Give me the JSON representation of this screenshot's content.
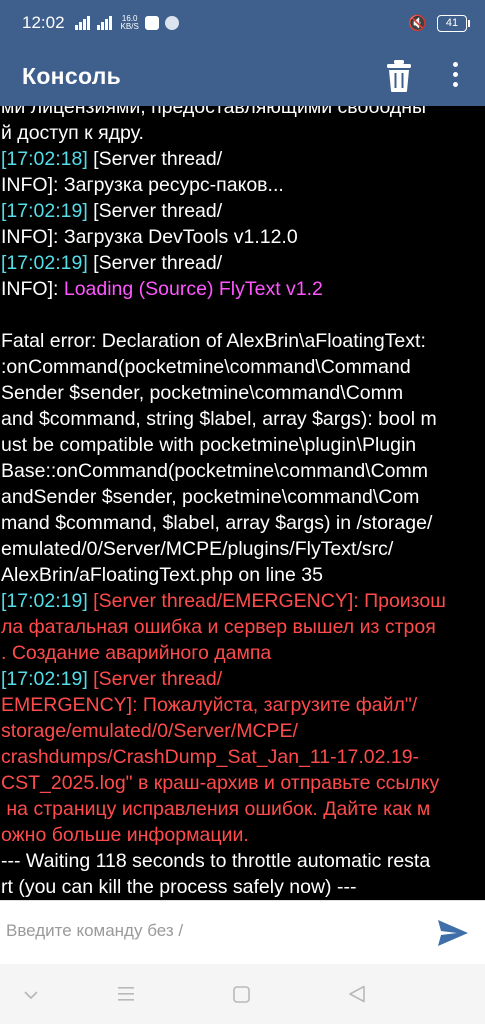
{
  "status_bar": {
    "time": "12:02",
    "network_speed": "16.0",
    "network_unit": "KB/S",
    "battery": "41",
    "icons": [
      "signal-4g-icon",
      "signal-icon",
      "calendar-icon",
      "notification-icon",
      "mute-icon",
      "battery-icon"
    ]
  },
  "app_bar": {
    "title": "Консоль",
    "delete_icon": "trash-icon",
    "more_icon": "more-vert-icon"
  },
  "console": {
    "lines": [
      {
        "segments": [
          {
            "text": "ми лицензиями, предоставляющими свободны",
            "color": "#ffffff"
          }
        ]
      },
      {
        "segments": [
          {
            "text": "й доступ к ядру.",
            "color": "#ffffff"
          }
        ]
      },
      {
        "segments": [
          {
            "text": "[17:02:18]",
            "color": "#55dde8"
          },
          {
            "text": " [Server thread/",
            "color": "#ffffff"
          }
        ]
      },
      {
        "segments": [
          {
            "text": "INFO]: Загрузка ресурс-паков...",
            "color": "#ffffff"
          }
        ]
      },
      {
        "segments": [
          {
            "text": "[17:02:19]",
            "color": "#55dde8"
          },
          {
            "text": " [Server thread/",
            "color": "#ffffff"
          }
        ]
      },
      {
        "segments": [
          {
            "text": "INFO]: Загрузка DevTools v1.12.0",
            "color": "#ffffff"
          }
        ]
      },
      {
        "segments": [
          {
            "text": "[17:02:19]",
            "color": "#55dde8"
          },
          {
            "text": " [Server thread/",
            "color": "#ffffff"
          }
        ]
      },
      {
        "segments": [
          {
            "text": "INFO]: ",
            "color": "#ffffff"
          },
          {
            "text": "Loading (Source) FlyText v1.2",
            "color": "#ff55ff"
          }
        ]
      },
      {
        "segments": [
          {
            "text": "",
            "color": "#ffffff"
          }
        ]
      },
      {
        "segments": [
          {
            "text": "Fatal error: Declaration of AlexBrin\\aFloatingText:",
            "color": "#ffffff"
          }
        ]
      },
      {
        "segments": [
          {
            "text": ":onCommand(pocketmine\\command\\Command",
            "color": "#ffffff"
          }
        ]
      },
      {
        "segments": [
          {
            "text": "Sender $sender, pocketmine\\command\\Comm",
            "color": "#ffffff"
          }
        ]
      },
      {
        "segments": [
          {
            "text": "and $command, string $label, array $args): bool m",
            "color": "#ffffff"
          }
        ]
      },
      {
        "segments": [
          {
            "text": "ust be compatible with pocketmine\\plugin\\Plugin",
            "color": "#ffffff"
          }
        ]
      },
      {
        "segments": [
          {
            "text": "Base::onCommand(pocketmine\\command\\Comm",
            "color": "#ffffff"
          }
        ]
      },
      {
        "segments": [
          {
            "text": "andSender $sender, pocketmine\\command\\Com",
            "color": "#ffffff"
          }
        ]
      },
      {
        "segments": [
          {
            "text": "mand $command, $label, array $args) in /storage/",
            "color": "#ffffff"
          }
        ]
      },
      {
        "segments": [
          {
            "text": "emulated/0/Server/MCPE/plugins/FlyText/src/",
            "color": "#ffffff"
          }
        ]
      },
      {
        "segments": [
          {
            "text": "AlexBrin/aFloatingText.php on line 35",
            "color": "#ffffff"
          }
        ]
      },
      {
        "segments": [
          {
            "text": "[17:02:19]",
            "color": "#55dde8"
          },
          {
            "text": " [Server thread/EMERGENCY]: Произош",
            "color": "#ff4b4b"
          }
        ]
      },
      {
        "segments": [
          {
            "text": "ла фатальная ошибка и сервер вышел из строя",
            "color": "#ff4b4b"
          }
        ]
      },
      {
        "segments": [
          {
            "text": ". Создание аварийного дампа",
            "color": "#ff4b4b"
          }
        ]
      },
      {
        "segments": [
          {
            "text": "[17:02:19]",
            "color": "#55dde8"
          },
          {
            "text": " [Server thread/",
            "color": "#ff4b4b"
          }
        ]
      },
      {
        "segments": [
          {
            "text": "EMERGENCY]: Пожалуйста, загрузите файл\"/",
            "color": "#ff4b4b"
          }
        ]
      },
      {
        "segments": [
          {
            "text": "storage/emulated/0/Server/MCPE/",
            "color": "#ff4b4b"
          }
        ]
      },
      {
        "segments": [
          {
            "text": "crashdumps/CrashDump_Sat_Jan_11-17.02.19-",
            "color": "#ff4b4b"
          }
        ]
      },
      {
        "segments": [
          {
            "text": "CST_2025.log\" в краш-архив и отправьте ссылку",
            "color": "#ff4b4b"
          }
        ]
      },
      {
        "segments": [
          {
            "text": " на страницу исправления ошибок. Дайте как м",
            "color": "#ff4b4b"
          }
        ]
      },
      {
        "segments": [
          {
            "text": "ожно больше информации.",
            "color": "#ff4b4b"
          }
        ]
      },
      {
        "segments": [
          {
            "text": "--- Waiting 118 seconds to throttle automatic resta",
            "color": "#ffffff"
          }
        ]
      },
      {
        "segments": [
          {
            "text": "rt (you can kill the process safely now) ---",
            "color": "#ffffff"
          }
        ]
      }
    ]
  },
  "input": {
    "placeholder": "Введите команду без /",
    "send_icon": "send-icon"
  },
  "nav_bar": {
    "icons": [
      "nav-down-icon",
      "nav-menu-icon",
      "nav-home-icon",
      "nav-back-icon"
    ]
  }
}
